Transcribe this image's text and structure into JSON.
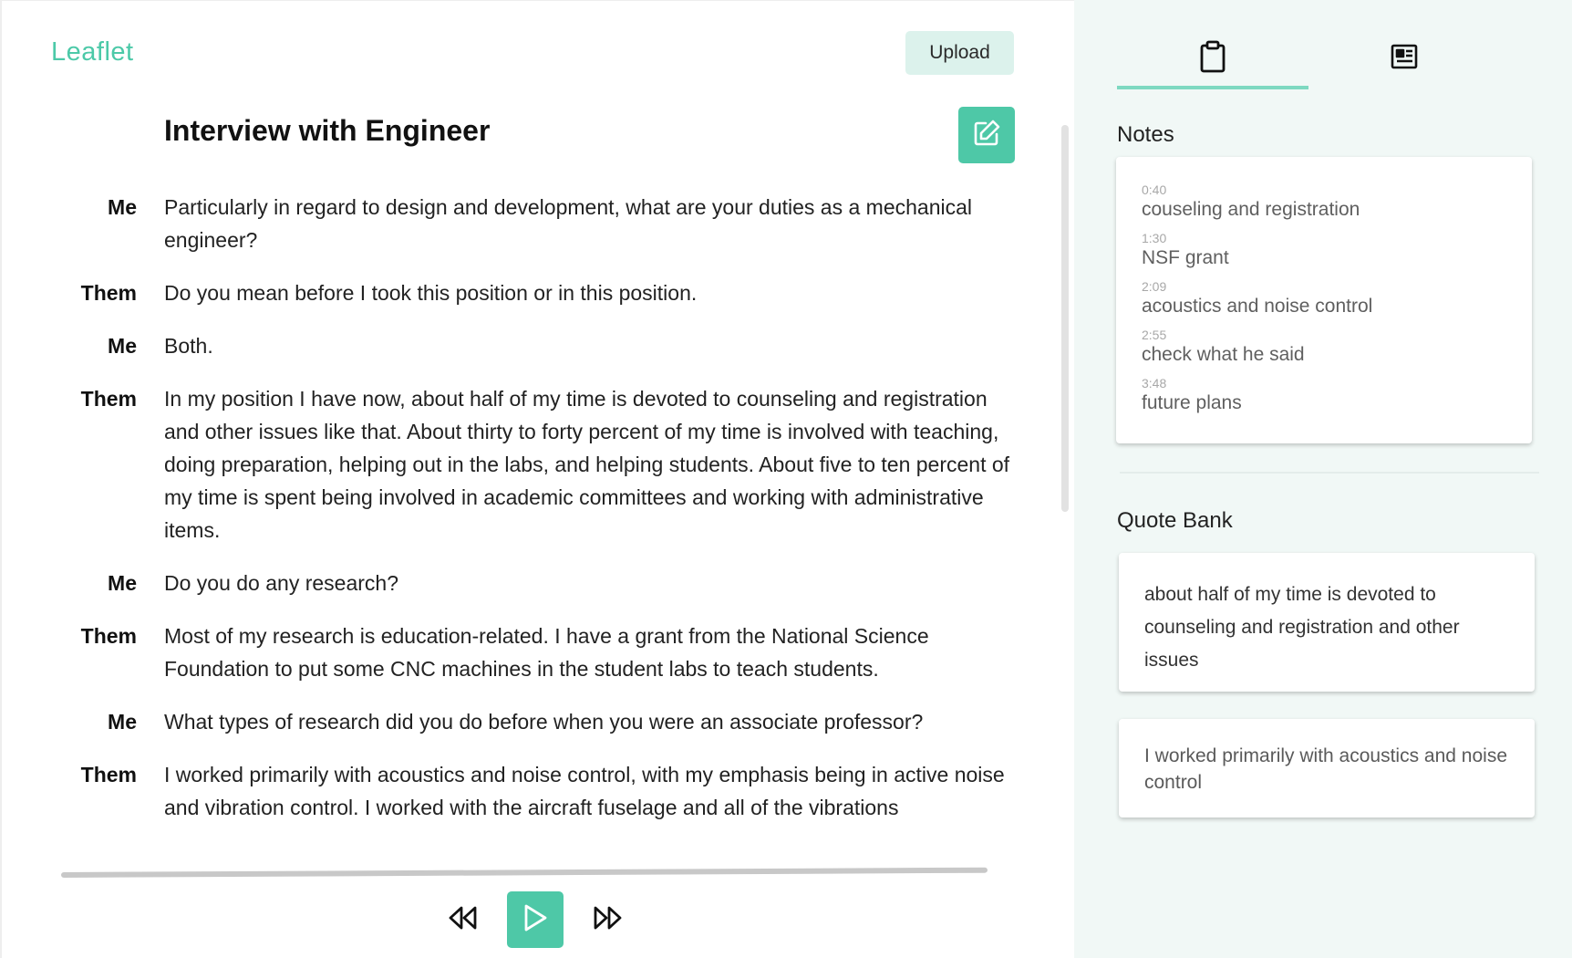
{
  "app": {
    "name": "Leaflet",
    "accent": "#4cc9a8"
  },
  "header": {
    "upload_label": "Upload"
  },
  "document": {
    "title": "Interview with Engineer"
  },
  "transcript": [
    {
      "speaker": "Me",
      "text": "Particularly in regard to design and development, what are your duties as a mechanical engineer?"
    },
    {
      "speaker": "Them",
      "text": "Do you mean before I took this position or in this position."
    },
    {
      "speaker": "Me",
      "text": "Both."
    },
    {
      "speaker": "Them",
      "text": "In my position I have now, about half of my time is devoted to counseling and registration and other issues like that. About thirty to forty percent of my time is involved with teaching, doing preparation, helping out in the labs, and helping students. About five to ten percent of my time is spent being involved in academic committees and working with administrative items."
    },
    {
      "speaker": "Me",
      "text": "Do you do any research?"
    },
    {
      "speaker": "Them",
      "text": "Most of my research is education-related. I have a grant from the National Science Foundation to put some CNC machines in the student labs to teach students."
    },
    {
      "speaker": "Me",
      "text": "What types of research did you do before when you were an associate professor?"
    },
    {
      "speaker": "Them",
      "text": "I worked primarily with acoustics and noise control, with my emphasis being in active noise and vibration control. I worked with the aircraft fuselage and all of the vibrations"
    }
  ],
  "player": {
    "icons": [
      "rewind-icon",
      "play-icon",
      "fast-forward-icon"
    ]
  },
  "sidebar": {
    "tabs": [
      {
        "icon": "clipboard-icon",
        "active": true
      },
      {
        "icon": "newspaper-icon",
        "active": false
      }
    ],
    "notes_title": "Notes",
    "notes": [
      {
        "time": "0:40",
        "text": "couseling and registration"
      },
      {
        "time": "1:30",
        "text": "NSF grant"
      },
      {
        "time": "2:09",
        "text": "acoustics and noise control"
      },
      {
        "time": "2:55",
        "text": "check what he said"
      },
      {
        "time": "3:48",
        "text": "future plans"
      }
    ],
    "quote_bank_title": "Quote Bank",
    "quotes": [
      {
        "text": "about half of my time is devoted to counseling and registration and other issues"
      },
      {
        "text": "I worked primarily with acoustics and noise control"
      }
    ]
  },
  "colors": {
    "accent": "#4ec8a7",
    "upload_bg": "#dcf2ec",
    "sidebar_bg": "#f1f8f6",
    "tab_indicator": "#7ed9c1"
  }
}
